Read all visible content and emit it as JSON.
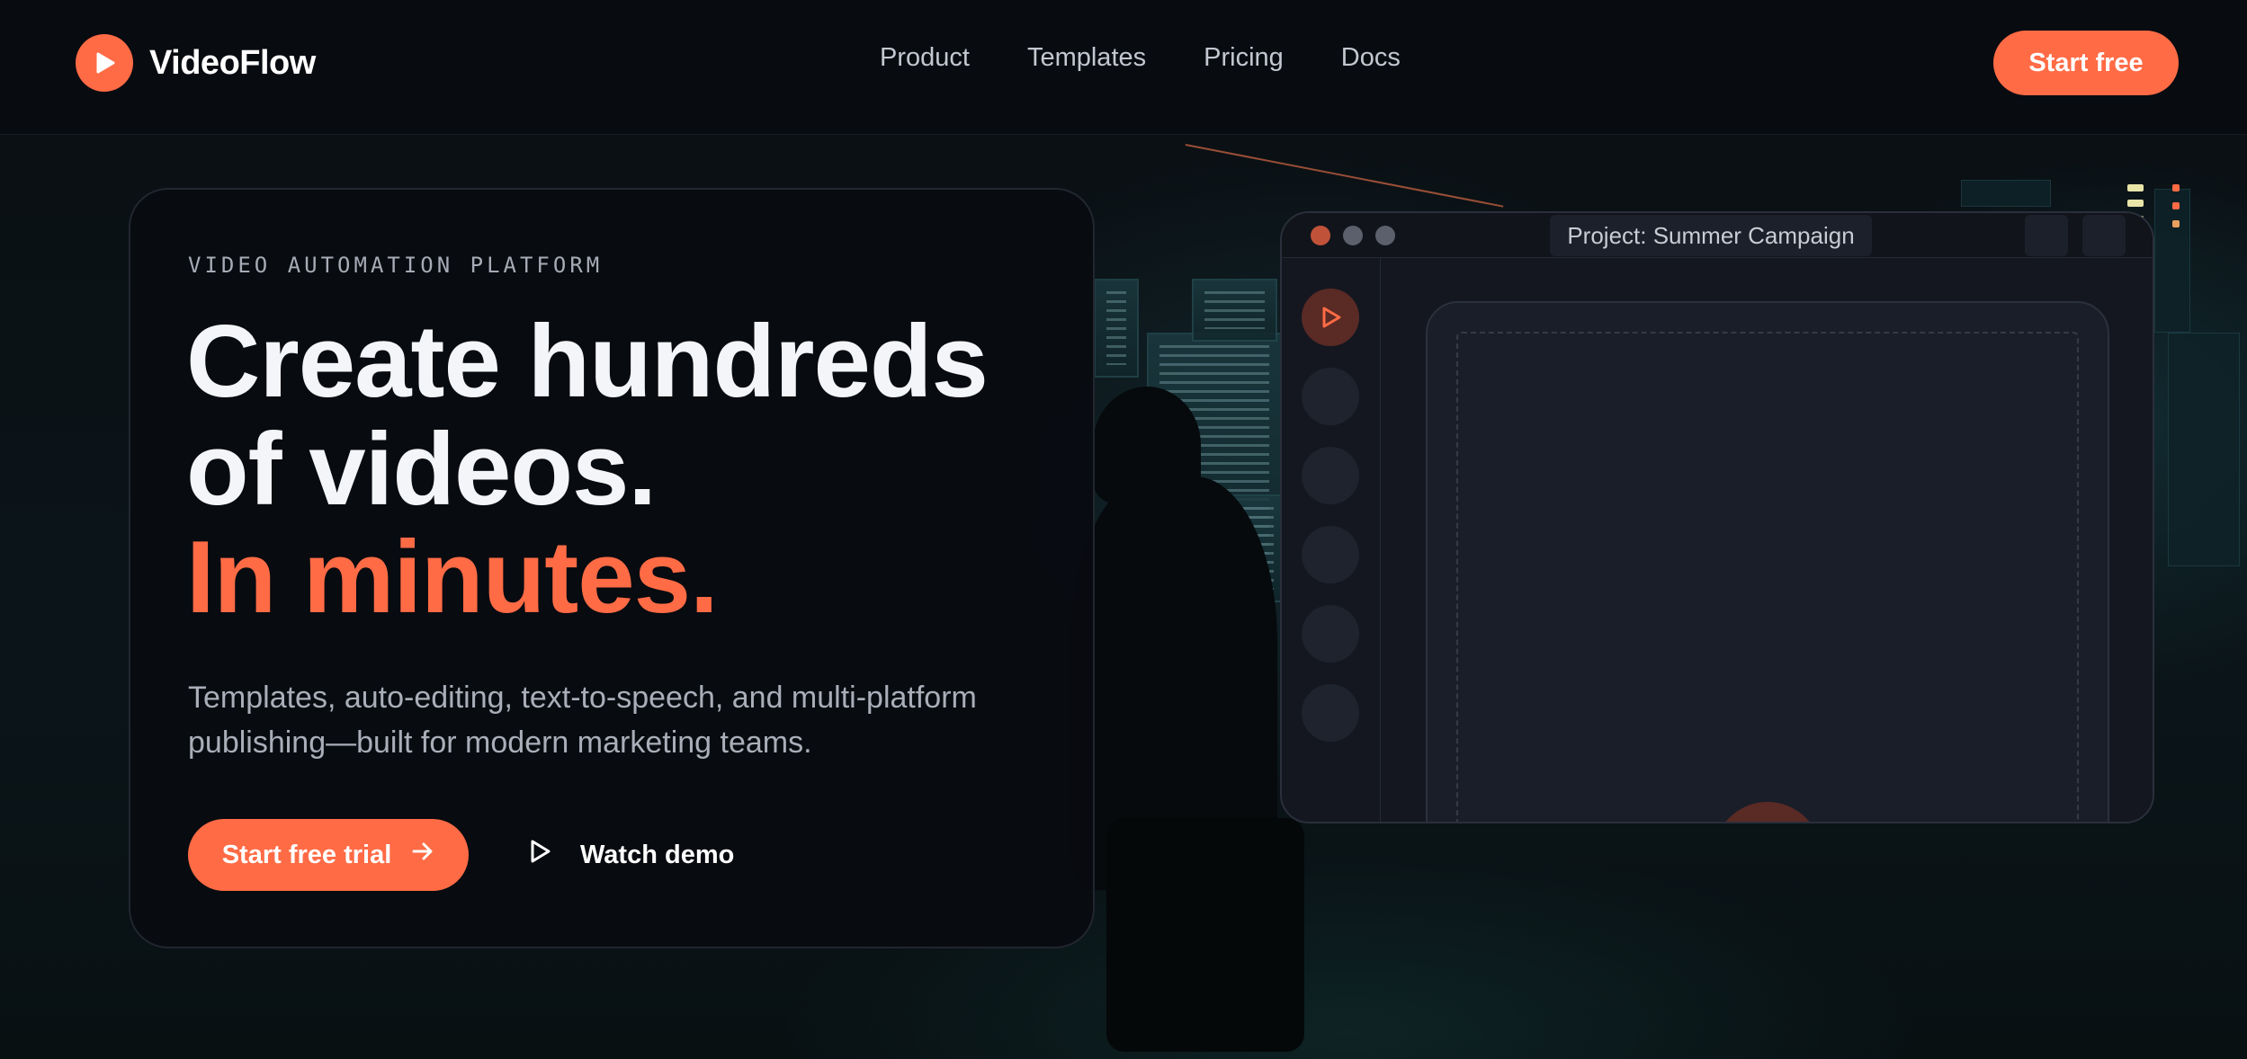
{
  "header": {
    "brand_name": "VideoFlow",
    "nav": [
      "Product",
      "Templates",
      "Pricing",
      "Docs"
    ],
    "cta_label": "Start free"
  },
  "hero": {
    "eyebrow": "VIDEO AUTOMATION PLATFORM",
    "headline_line1": "Create hundreds",
    "headline_line2": "of videos.",
    "headline_accent": "In minutes.",
    "subtitle": "Templates, auto-editing, text-to-speech, and multi-platform publishing—built for modern marketing teams.",
    "primary_button": "Start free trial",
    "secondary_button": "Watch demo"
  },
  "preview": {
    "project_tab": "Project: Summer Campaign"
  },
  "colors": {
    "accent": "#ff6b45",
    "background": "#07090d",
    "card": "#0a0c11"
  },
  "icons": {
    "brand_logo": "play-circle-icon",
    "arrow": "arrow-right-icon",
    "watch": "play-outline-icon"
  }
}
